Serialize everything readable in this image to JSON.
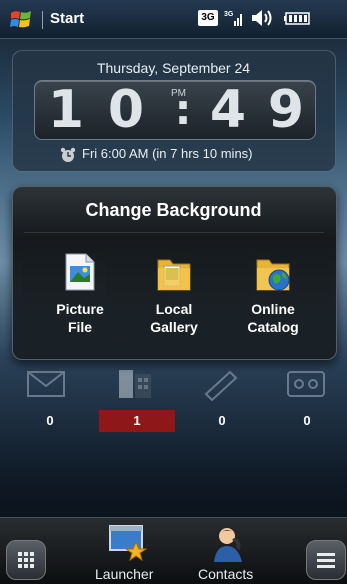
{
  "status_bar": {
    "start_label": "Start",
    "network_badge": "3G",
    "icons": [
      "windows-flag-icon",
      "signal-icon",
      "speaker-icon",
      "battery-icon"
    ]
  },
  "clock": {
    "date": "Thursday, September 24",
    "hour_tens": "1",
    "hour_ones": "0",
    "separator": ":",
    "minute_tens": "4",
    "minute_ones": "9",
    "ampm": "PM",
    "alarm_text": "Fri 6:00 AM (in 7 hrs 10 mins)"
  },
  "dialog": {
    "title": "Change Background",
    "options": [
      {
        "line1": "Picture",
        "line2": "File",
        "icon": "picture-file-icon"
      },
      {
        "line1": "Local",
        "line2": "Gallery",
        "icon": "local-gallery-icon"
      },
      {
        "line1": "Online",
        "line2": "Catalog",
        "icon": "online-catalog-icon"
      }
    ]
  },
  "tiles": {
    "counts": [
      "0",
      "1",
      "0",
      "0"
    ],
    "active_color": "#8e1818"
  },
  "bottom_bar": {
    "launcher_label": "Launcher",
    "contacts_label": "Contacts"
  }
}
